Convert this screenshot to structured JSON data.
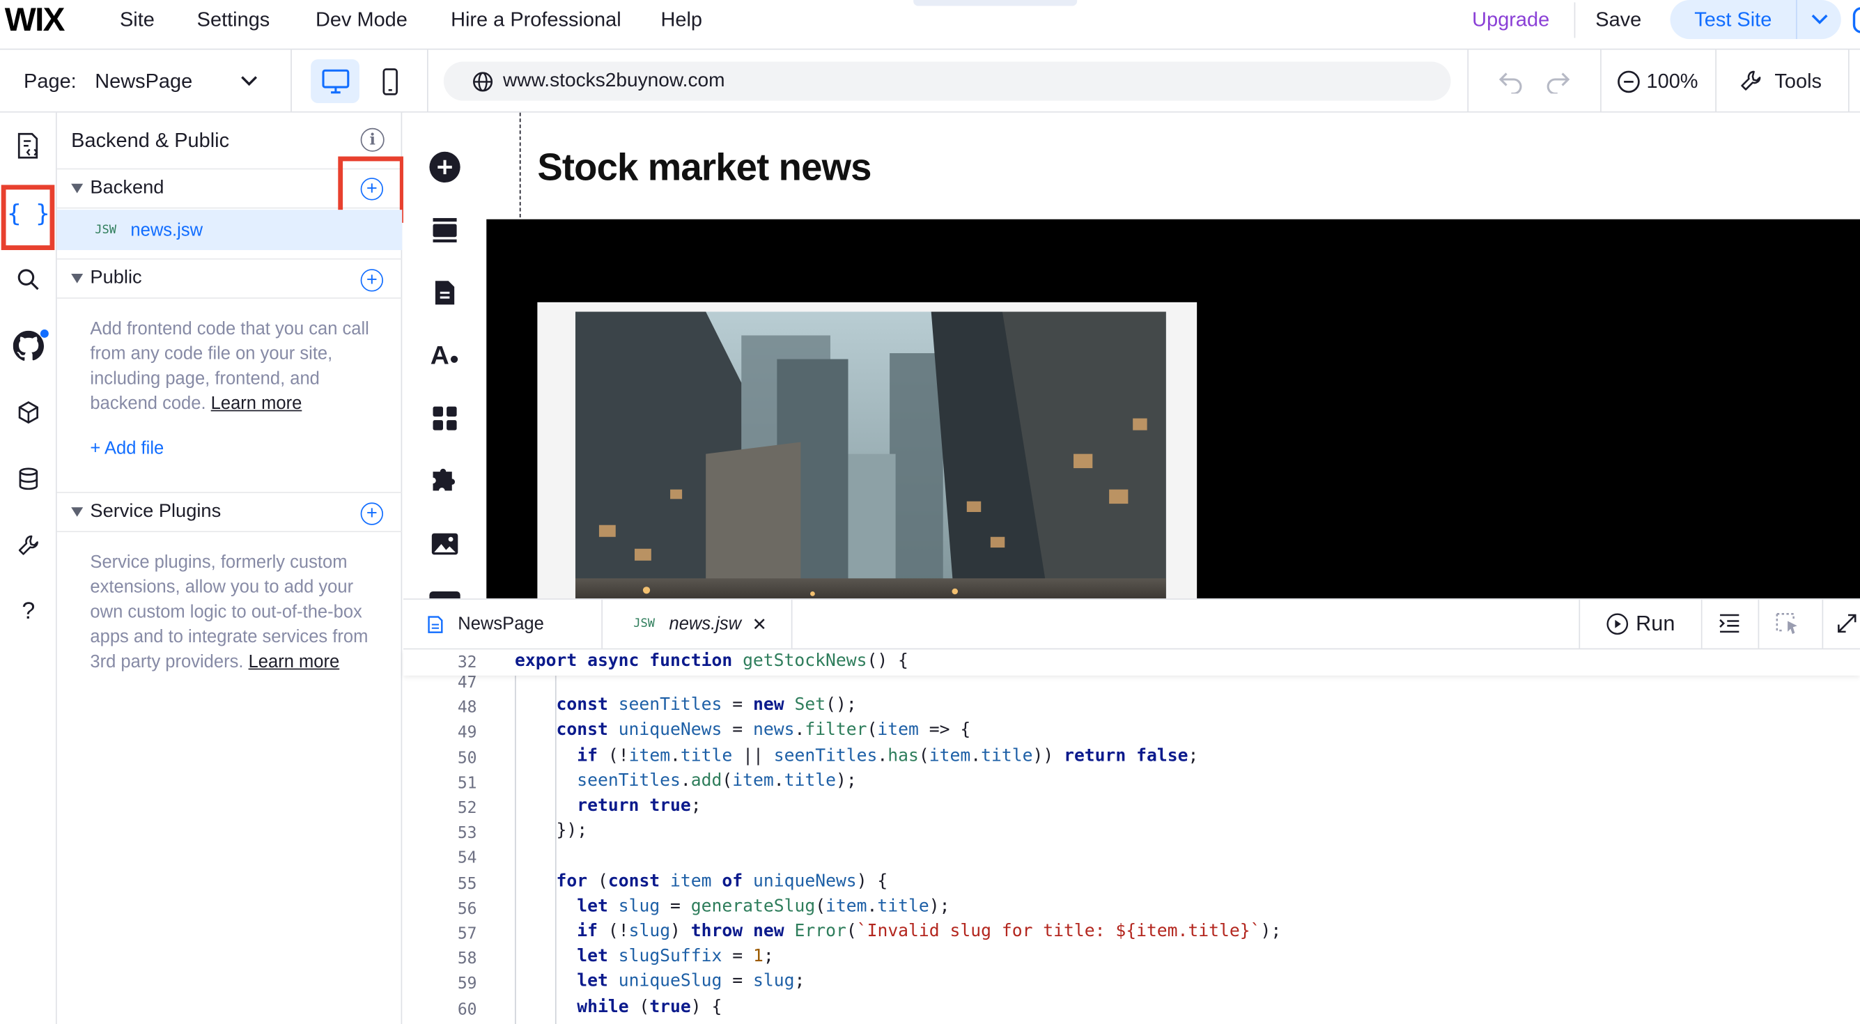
{
  "topbar": {
    "logo": "WIX",
    "menu": [
      "Site",
      "Settings",
      "Dev Mode",
      "Hire a Professional",
      "Help"
    ],
    "upgrade": "Upgrade",
    "save": "Save",
    "test_site": "Test Site"
  },
  "secbar": {
    "page_label": "Page:",
    "page_name": "NewsPage",
    "url": "www.stocks2buynow.com",
    "zoom": "100%",
    "tools": "Tools"
  },
  "panel": {
    "title": "Backend & Public",
    "backend": {
      "label": "Backend",
      "file_badge": "JSW",
      "file_name": "news.jsw"
    },
    "public": {
      "label": "Public",
      "description": "Add frontend code that you can call from any code file on your site, including page, frontend, and backend code.",
      "learn_more": "Learn more",
      "add_file": "+ Add file"
    },
    "service_plugins": {
      "label": "Service Plugins",
      "description": "Service plugins, formerly custom extensions, allow you to add your own custom logic to out-of-the-box apps and to integrate services from 3rd party providers.",
      "learn_more": "Learn more"
    }
  },
  "canvas": {
    "heading": "Stock market news"
  },
  "editor": {
    "tab_page": "NewsPage",
    "tab_file_badge": "JSW",
    "tab_file": "news.jsw",
    "run": "Run",
    "sticky_line": {
      "num": "32",
      "code": "export async function getStockNews() {"
    },
    "lines": [
      {
        "num": "47",
        "code": ""
      },
      {
        "num": "48",
        "code": "    const seenTitles = new Set();"
      },
      {
        "num": "49",
        "code": "    const uniqueNews = news.filter(item => {"
      },
      {
        "num": "50",
        "code": "      if (!item.title || seenTitles.has(item.title)) return false;"
      },
      {
        "num": "51",
        "code": "      seenTitles.add(item.title);"
      },
      {
        "num": "52",
        "code": "      return true;"
      },
      {
        "num": "53",
        "code": "    });"
      },
      {
        "num": "54",
        "code": ""
      },
      {
        "num": "55",
        "code": "    for (const item of uniqueNews) {"
      },
      {
        "num": "56",
        "code": "      let slug = generateSlug(item.title);"
      },
      {
        "num": "57",
        "code": "      if (!slug) throw new Error(`Invalid slug for title: ${item.title}`);"
      },
      {
        "num": "58",
        "code": "      let slugSuffix = 1;"
      },
      {
        "num": "59",
        "code": "      let uniqueSlug = slug;"
      },
      {
        "num": "60",
        "code": "      while (true) {"
      }
    ]
  },
  "colors": {
    "accent": "#116dff",
    "highlight": "#e8402e",
    "upgrade": "#8a3fd6"
  }
}
